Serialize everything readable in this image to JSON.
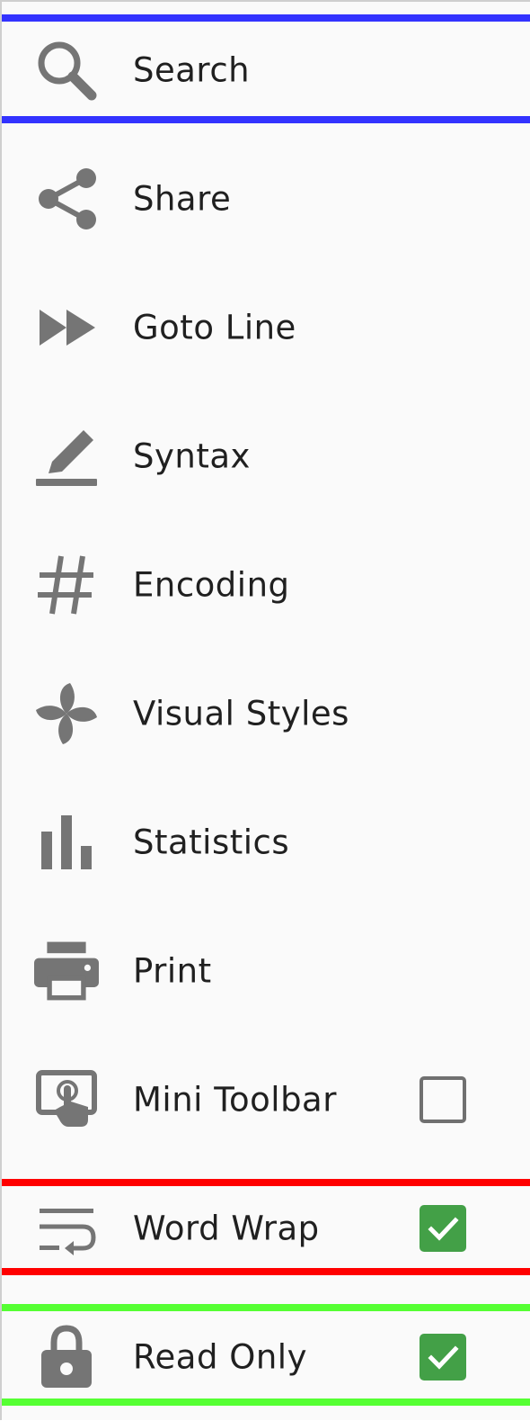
{
  "menu": {
    "items": [
      {
        "label": "Search",
        "icon": "search-icon"
      },
      {
        "label": "Share",
        "icon": "share-icon"
      },
      {
        "label": "Goto Line",
        "icon": "fast-forward-icon"
      },
      {
        "label": "Syntax",
        "icon": "pen-underline-icon"
      },
      {
        "label": "Encoding",
        "icon": "hash-icon"
      },
      {
        "label": "Visual Styles",
        "icon": "pinwheel-icon"
      },
      {
        "label": "Statistics",
        "icon": "bar-chart-icon"
      },
      {
        "label": "Print",
        "icon": "printer-icon"
      },
      {
        "label": "Mini Toolbar",
        "icon": "touch-app-icon",
        "checked": false
      },
      {
        "label": "Word Wrap",
        "icon": "wrap-text-icon",
        "checked": true
      },
      {
        "label": "Read Only",
        "icon": "lock-icon",
        "checked": true
      }
    ]
  },
  "colors": {
    "search_highlight": "#3333ff",
    "word_wrap_highlight": "#ff0000",
    "read_only_highlight": "#55ff33",
    "checkbox_on": "#43a047",
    "icon": "#757575"
  }
}
